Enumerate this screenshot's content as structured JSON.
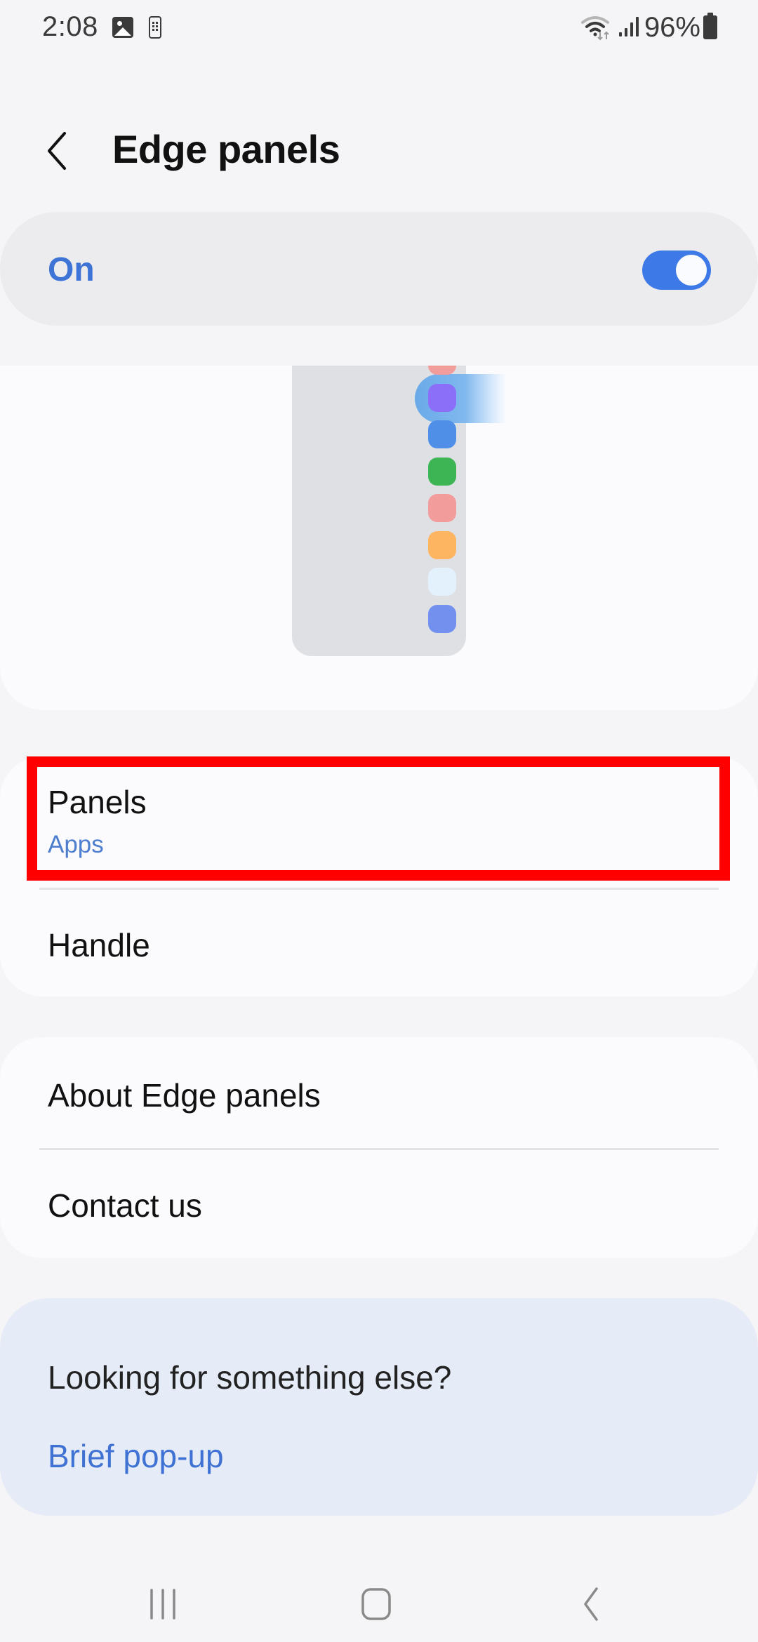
{
  "status_bar": {
    "time": "2:08",
    "battery_percent": "96%",
    "icons": [
      "gallery-icon",
      "remote-icon",
      "wifi-icon",
      "signal-icon",
      "battery-icon"
    ]
  },
  "header": {
    "back_icon": "chevron-left-icon",
    "title": "Edge panels"
  },
  "master_switch": {
    "label": "On",
    "enabled": true,
    "accent_color": "#3d7ae8"
  },
  "preview": {
    "edge_icon_colors": [
      "#f29d9b",
      "#8b6ff8",
      "#4f8fe8",
      "#3db554",
      "#f29c9c",
      "#fdb561",
      "#e3f1fc",
      "#7290ee"
    ],
    "highlighted_index": 1
  },
  "settings_group_1": {
    "items": [
      {
        "title": "Panels",
        "subtitle": "Apps"
      },
      {
        "title": "Handle"
      }
    ]
  },
  "settings_group_2": {
    "items": [
      {
        "title": "About Edge panels"
      },
      {
        "title": "Contact us"
      }
    ]
  },
  "suggestions": {
    "title": "Looking for something else?",
    "links": [
      "Brief pop-up"
    ]
  },
  "nav_bar": {
    "recents_icon": "recents-icon",
    "home_icon": "home-icon",
    "back_icon": "back-icon"
  },
  "annotation": {
    "highlight_color": "#ff0000",
    "highlighted_item": "Panels"
  }
}
